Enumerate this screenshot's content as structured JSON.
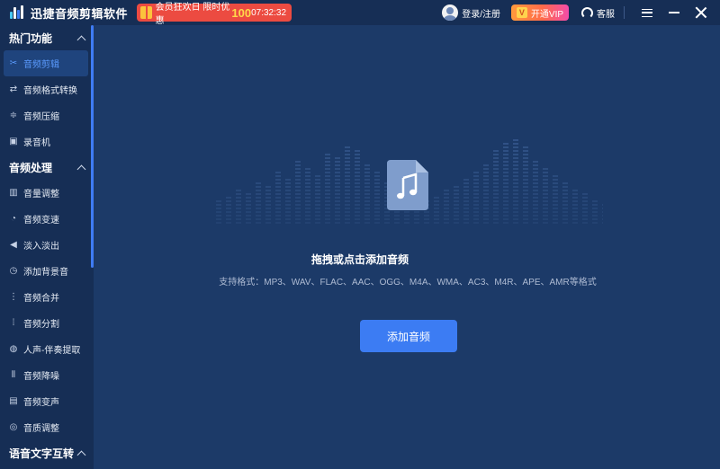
{
  "app": {
    "title": "迅捷音频剪辑软件"
  },
  "promo": {
    "text": "会员狂欢日 限时优惠",
    "percent": "100",
    "timer": "07:32:32"
  },
  "header": {
    "login_label": "登录/注册",
    "vip_badge": "V",
    "vip_label": "开通VIP",
    "service_label": "客服"
  },
  "sidebar": {
    "sections": [
      {
        "title": "热门功能",
        "items": [
          {
            "label": "音频剪辑",
            "icon": "scissors-icon",
            "active": true
          },
          {
            "label": "音频格式转换",
            "icon": "convert-icon"
          },
          {
            "label": "音频压缩",
            "icon": "compress-icon"
          },
          {
            "label": "录音机",
            "icon": "recorder-icon"
          }
        ]
      },
      {
        "title": "音频处理",
        "items": [
          {
            "label": "音量调整",
            "icon": "volume-icon"
          },
          {
            "label": "音频变速",
            "icon": "speed-icon"
          },
          {
            "label": "淡入淡出",
            "icon": "fade-icon"
          },
          {
            "label": "添加背景音",
            "icon": "bg-music-icon"
          },
          {
            "label": "音频合并",
            "icon": "merge-icon"
          },
          {
            "label": "音频分割",
            "icon": "split-icon"
          },
          {
            "label": "人声-伴奏提取",
            "icon": "vocal-icon"
          },
          {
            "label": "音频降噪",
            "icon": "denoise-icon"
          },
          {
            "label": "音频变声",
            "icon": "voice-change-icon"
          },
          {
            "label": "音质调整",
            "icon": "quality-icon"
          }
        ]
      },
      {
        "title": "语音文字互转",
        "items": []
      }
    ]
  },
  "main": {
    "drop_title": "拖拽或点击添加音频",
    "formats_text": "支持格式：MP3、WAV、FLAC、AAC、OGG、M4A、WMA、AC3、M4R、APE、AMR等格式",
    "add_button": "添加音频"
  },
  "colors": {
    "sidebar_bg": "#162e55",
    "main_bg": "#1c3a68",
    "accent": "#3c7cf3",
    "promo": "#ec4b41"
  }
}
